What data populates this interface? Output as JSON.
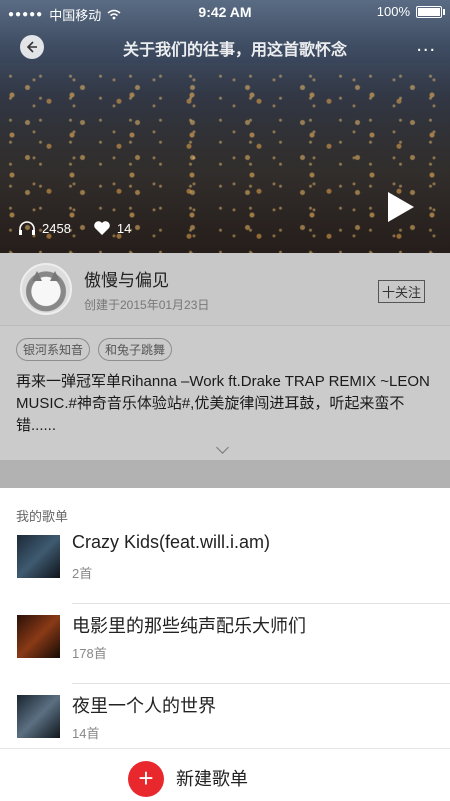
{
  "status_bar": {
    "carrier": "中国移动",
    "time": "9:42 AM",
    "battery": "100%",
    "battery_level": 1.0
  },
  "nav": {
    "title": "关于我们的往事，用这首歌怀念",
    "more": "..."
  },
  "hero": {
    "listen_count": "2458",
    "like_count": "14"
  },
  "profile": {
    "name": "傲慢与偏见",
    "created": "创建于2015年01月23日",
    "follow_label": "十关注"
  },
  "tags": [
    "银河系知音",
    "和兔子跳舞"
  ],
  "description": "再来一弹冠军单Rihanna –Work ft.Drake  TRAP REMIX ~LEON MUSIC.#神奇音乐体验站#,优美旋律闯进耳鼓，听起来蛮不错......",
  "sheet": {
    "title": "我的歌单",
    "playlists": [
      {
        "name": "Crazy Kids(feat.will.i.am)",
        "count": "2首"
      },
      {
        "name": "电影里的那些纯声配乐大师们",
        "count": "178首"
      },
      {
        "name": "夜里一个人的世界",
        "count": "14首"
      }
    ],
    "new_label": "新建歌单"
  },
  "colors": {
    "accent": "#e8282d",
    "overlay": "#c8c8c8"
  }
}
